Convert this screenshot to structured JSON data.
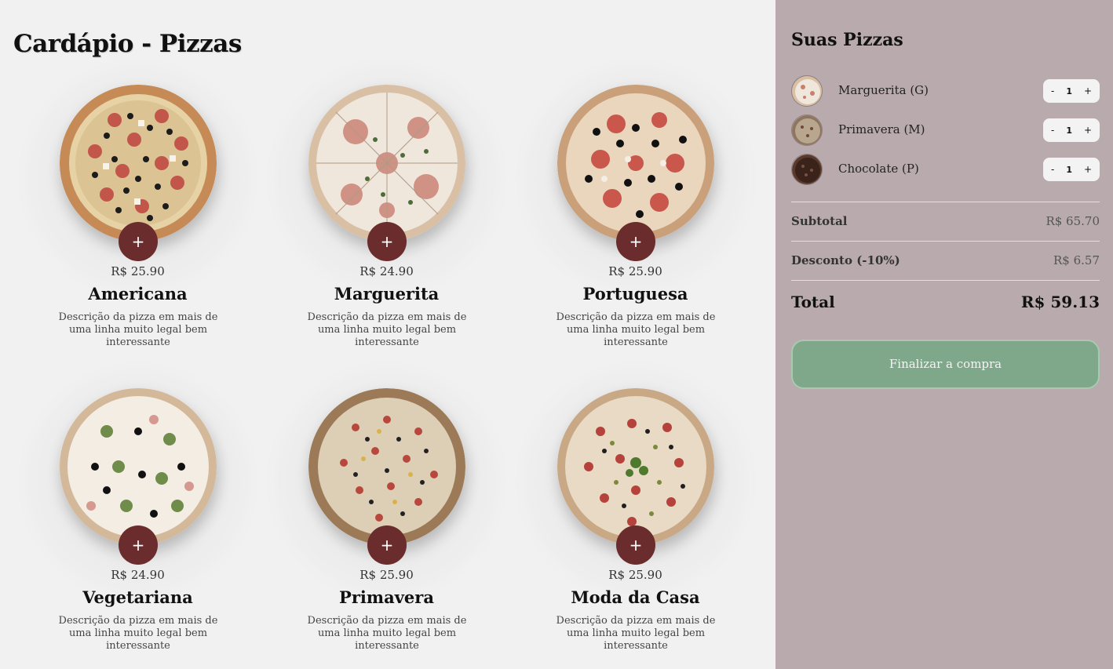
{
  "menu": {
    "title": "Cardápio - Pizzas",
    "add_label": "+",
    "pizzas": [
      {
        "name": "Americana",
        "price": "R$ 25.90",
        "desc": "Descrição da pizza em mais de uma linha muito legal bem interessante"
      },
      {
        "name": "Marguerita",
        "price": "R$ 24.90",
        "desc": "Descrição da pizza em mais de uma linha muito legal bem interessante"
      },
      {
        "name": "Portuguesa",
        "price": "R$ 25.90",
        "desc": "Descrição da pizza em mais de uma linha muito legal bem interessante"
      },
      {
        "name": "Vegetariana",
        "price": "R$ 24.90",
        "desc": "Descrição da pizza em mais de uma linha muito legal bem interessante"
      },
      {
        "name": "Primavera",
        "price": "R$ 25.90",
        "desc": "Descrição da pizza em mais de uma linha muito legal bem interessante"
      },
      {
        "name": "Moda da Casa",
        "price": "R$ 25.90",
        "desc": "Descrição da pizza em mais de uma linha muito legal bem interessante"
      }
    ]
  },
  "cart": {
    "title": "Suas Pizzas",
    "items": [
      {
        "name": "Marguerita (G)",
        "qty": "1",
        "minus": "-",
        "plus": "+"
      },
      {
        "name": "Primavera (M)",
        "qty": "1",
        "minus": "-",
        "plus": "+"
      },
      {
        "name": "Chocolate (P)",
        "qty": "1",
        "minus": "-",
        "plus": "+"
      }
    ],
    "subtotal_label": "Subtotal",
    "subtotal_value": "R$ 65.70",
    "discount_label": "Desconto (-10%)",
    "discount_value": "R$ 6.57",
    "total_label": "Total",
    "total_value": "R$ 59.13",
    "checkout_label": "Finalizar a compra"
  },
  "colors": {
    "add_button": "#6a2c2c",
    "sidebar_bg": "#b8aaad",
    "checkout_bg": "#7fa88a",
    "page_bg": "#f1f1f1"
  }
}
